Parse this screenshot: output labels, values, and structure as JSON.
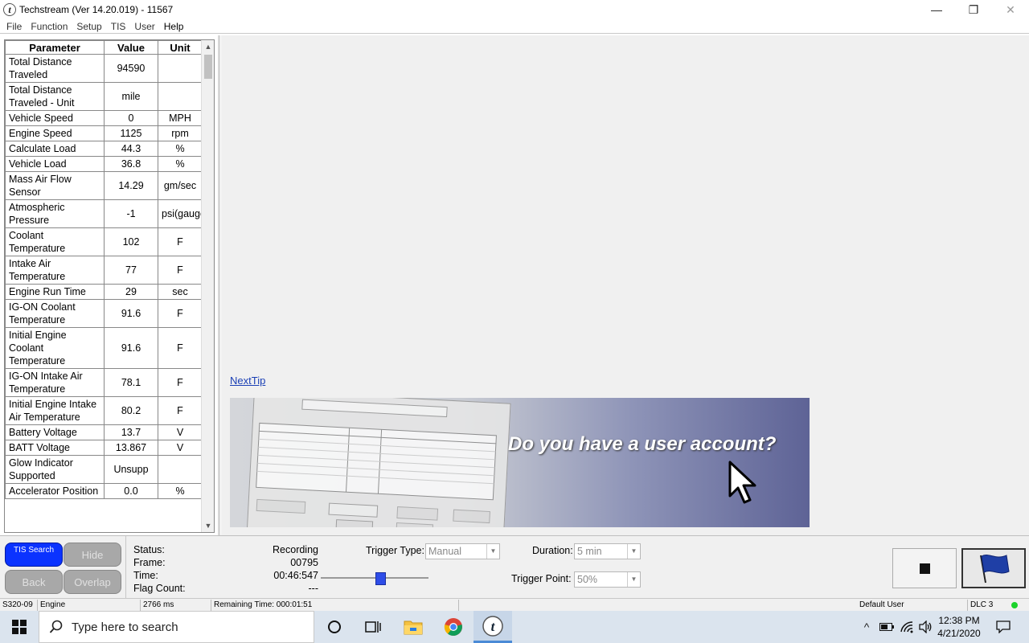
{
  "window": {
    "title": "Techstream (Ver 14.20.019) - 11567",
    "app_icon_glyph": "t",
    "controls": {
      "minimize": "—",
      "restore": "❐",
      "close": "✕"
    }
  },
  "menu": [
    "File",
    "Function",
    "Setup",
    "TIS",
    "User",
    "Help"
  ],
  "table": {
    "headers": {
      "parameter": "Parameter",
      "value": "Value",
      "unit": "Unit"
    },
    "rows": [
      {
        "parameter": "Total Distance Traveled",
        "value": "94590",
        "unit": ""
      },
      {
        "parameter": "Total Distance Traveled - Unit",
        "value": "mile",
        "unit": ""
      },
      {
        "parameter": "Vehicle Speed",
        "value": "0",
        "unit": "MPH"
      },
      {
        "parameter": "Engine Speed",
        "value": "1125",
        "unit": "rpm"
      },
      {
        "parameter": "Calculate Load",
        "value": "44.3",
        "unit": "%"
      },
      {
        "parameter": "Vehicle Load",
        "value": "36.8",
        "unit": "%"
      },
      {
        "parameter": "Mass Air Flow Sensor",
        "value": "14.29",
        "unit": "gm/sec"
      },
      {
        "parameter": "Atmospheric Pressure",
        "value": "-1",
        "unit": "psi(gauge)"
      },
      {
        "parameter": "Coolant Temperature",
        "value": "102",
        "unit": "F"
      },
      {
        "parameter": "Intake Air Temperature",
        "value": "77",
        "unit": "F"
      },
      {
        "parameter": "Engine Run Time",
        "value": "29",
        "unit": "sec"
      },
      {
        "parameter": "IG-ON Coolant Temperature",
        "value": "91.6",
        "unit": "F"
      },
      {
        "parameter": "Initial Engine Coolant Temperature",
        "value": "91.6",
        "unit": "F"
      },
      {
        "parameter": "IG-ON Intake Air Temperature",
        "value": "78.1",
        "unit": "F"
      },
      {
        "parameter": "Initial Engine Intake Air Temperature",
        "value": "80.2",
        "unit": "F"
      },
      {
        "parameter": "Battery Voltage",
        "value": "13.7",
        "unit": "V"
      },
      {
        "parameter": "BATT Voltage",
        "value": "13.867",
        "unit": "V"
      },
      {
        "parameter": "Glow Indicator Supported",
        "value": "Unsupp",
        "unit": ""
      },
      {
        "parameter": "Accelerator Position",
        "value": "0.0",
        "unit": "%"
      }
    ]
  },
  "tips": {
    "next_tip": "NextTip",
    "banner_text": "Do you have a user account?"
  },
  "controls": {
    "tis_search": "TIS Search",
    "hide": "Hide",
    "back": "Back",
    "overlap": "Overlap",
    "status_label": "Status:",
    "frame_label": "Frame:",
    "time_label": "Time:",
    "flag_count_label": "Flag Count:",
    "status_value": "Recording",
    "frame_value": "00795",
    "time_value": "00:46:547",
    "flag_count_value": "---",
    "trigger_type_label": "Trigger Type:",
    "trigger_type_value": "Manual",
    "duration_label": "Duration:",
    "duration_value": "5 min",
    "trigger_point_label": "Trigger Point:",
    "trigger_point_value": "50%",
    "playback_position": 0.56
  },
  "statusbar": {
    "code": "S320-09",
    "system": "Engine",
    "interval": "2766 ms",
    "remaining": "Remaining Time: 000:01:51",
    "user": "Default User",
    "connector": "DLC 3"
  },
  "taskbar": {
    "search_placeholder": "Type here to search",
    "time": "12:38 PM",
    "date": "4/21/2020"
  },
  "colors": {
    "tis_button": "#0b33ff",
    "link": "#1a3fb5",
    "led": "#1ad22a",
    "slider_thumb": "#2e4de8"
  }
}
